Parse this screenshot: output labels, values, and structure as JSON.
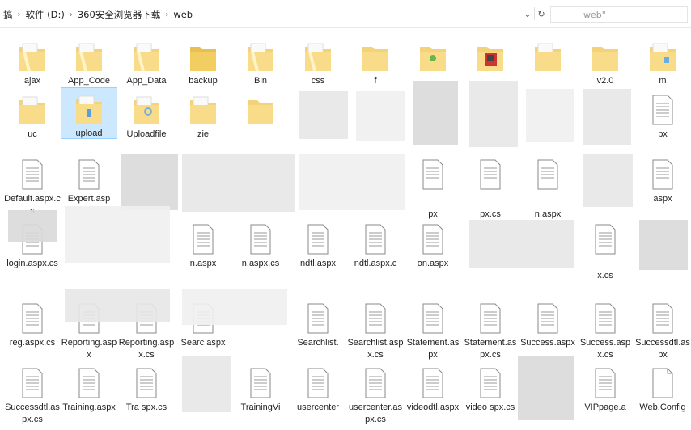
{
  "address_bar": {
    "crumbs": [
      "搞",
      "软件 (D:)",
      "360安全浏览器下载",
      "web"
    ],
    "search_text": "web\""
  },
  "folders_row1": [
    "ajax",
    "App_Code",
    "App_Data",
    "backup",
    "Bin",
    "css",
    "f",
    "",
    "",
    "",
    "v2.0",
    "m"
  ],
  "folders_row2": [
    "uc",
    "upload",
    "Uploadfile",
    "zie",
    "",
    "",
    "",
    "",
    "",
    "",
    "",
    "px"
  ],
  "row3": [
    "Default.aspx.cs",
    "Expert.asp",
    "",
    "",
    "",
    "",
    "",
    "px",
    "px.cs",
    "n.aspx",
    "",
    "aspx"
  ],
  "row4": [
    "login.aspx.cs",
    "",
    "",
    "n.aspx",
    "n.aspx.cs",
    "ndtl.aspx",
    "ndtl.aspx.c",
    "on.aspx",
    "",
    "",
    "x.cs",
    ""
  ],
  "row5": [
    "reg.aspx.cs",
    "Reporting.aspx",
    "Reporting.aspx.cs",
    "Searc aspx",
    "",
    "Searchlist.",
    "Searchlist.aspx.cs",
    "Statement.aspx",
    "Statement.aspx.cs",
    "Success.aspx",
    "Success.aspx.cs",
    "Successdtl.aspx"
  ],
  "row6": [
    "Successdtl.aspx.cs",
    "Training.aspx",
    "Tra spx.cs",
    "",
    "TrainingVi",
    "usercenter",
    "usercenter.aspx.cs",
    "videodtl.aspx",
    "video spx.cs",
    "",
    "VIPpage.a",
    "Web.Config"
  ]
}
